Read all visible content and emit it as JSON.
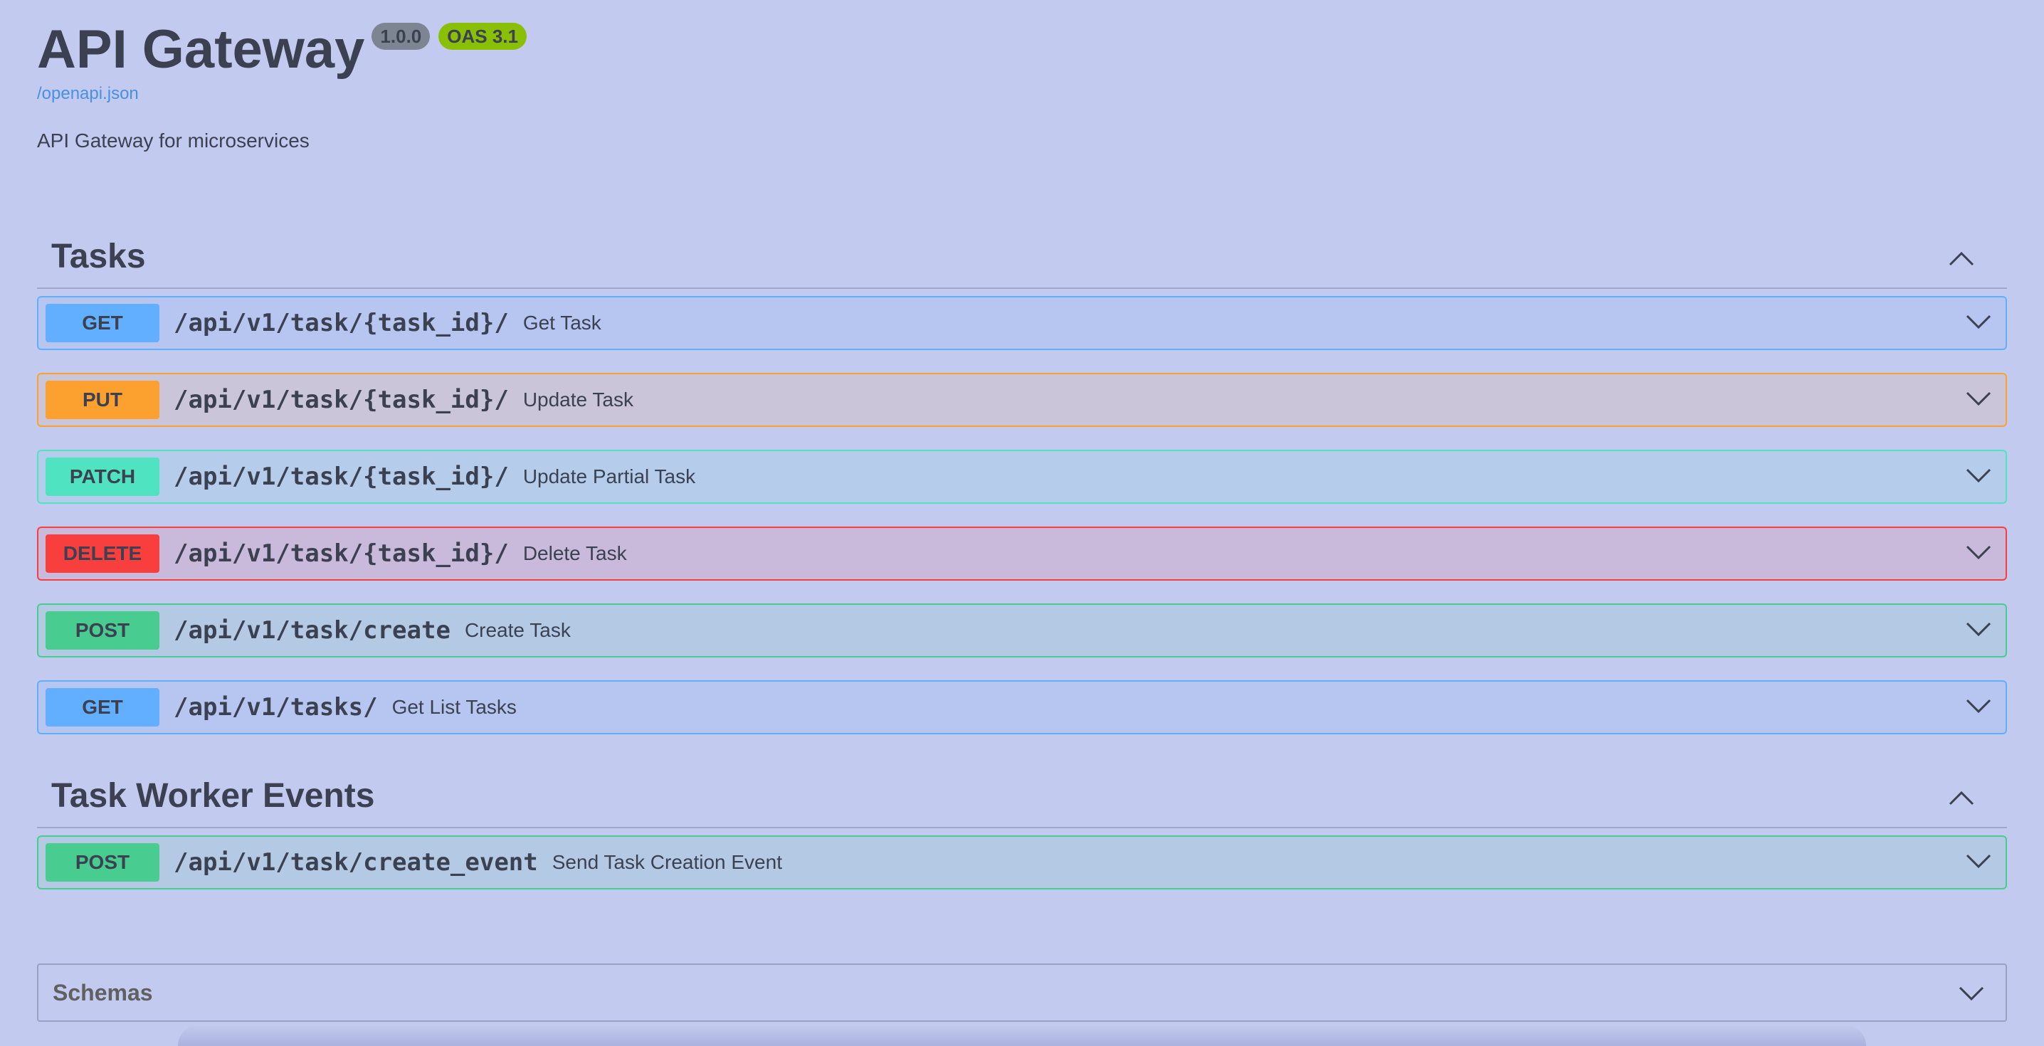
{
  "info": {
    "title": "API Gateway",
    "version": "1.0.0",
    "oas": "OAS 3.1",
    "spec_link": "/openapi.json",
    "description": "API Gateway for microservices"
  },
  "tags": [
    {
      "name": "Tasks",
      "operations": [
        {
          "method": "GET",
          "path": "/api/v1/task/{task_id}/",
          "summary": "Get Task"
        },
        {
          "method": "PUT",
          "path": "/api/v1/task/{task_id}/",
          "summary": "Update Task"
        },
        {
          "method": "PATCH",
          "path": "/api/v1/task/{task_id}/",
          "summary": "Update Partial Task"
        },
        {
          "method": "DELETE",
          "path": "/api/v1/task/{task_id}/",
          "summary": "Delete Task"
        },
        {
          "method": "POST",
          "path": "/api/v1/task/create",
          "summary": "Create Task"
        },
        {
          "method": "GET",
          "path": "/api/v1/tasks/",
          "summary": "Get List Tasks"
        }
      ]
    },
    {
      "name": "Task Worker Events",
      "operations": [
        {
          "method": "POST",
          "path": "/api/v1/task/create_event",
          "summary": "Send Task Creation Event"
        }
      ]
    }
  ],
  "schemas": {
    "title": "Schemas"
  },
  "colors": {
    "background": "#c3caef",
    "get": "#61affe",
    "put": "#fca130",
    "patch": "#50e3c2",
    "delete": "#f93e3e",
    "post": "#49cc90",
    "text": "#3b4151",
    "link": "#4990e2"
  },
  "icons": {
    "tag_toggle": "chevron-up-icon",
    "op_toggle": "chevron-down-icon",
    "schemas_toggle": "chevron-down-icon"
  }
}
